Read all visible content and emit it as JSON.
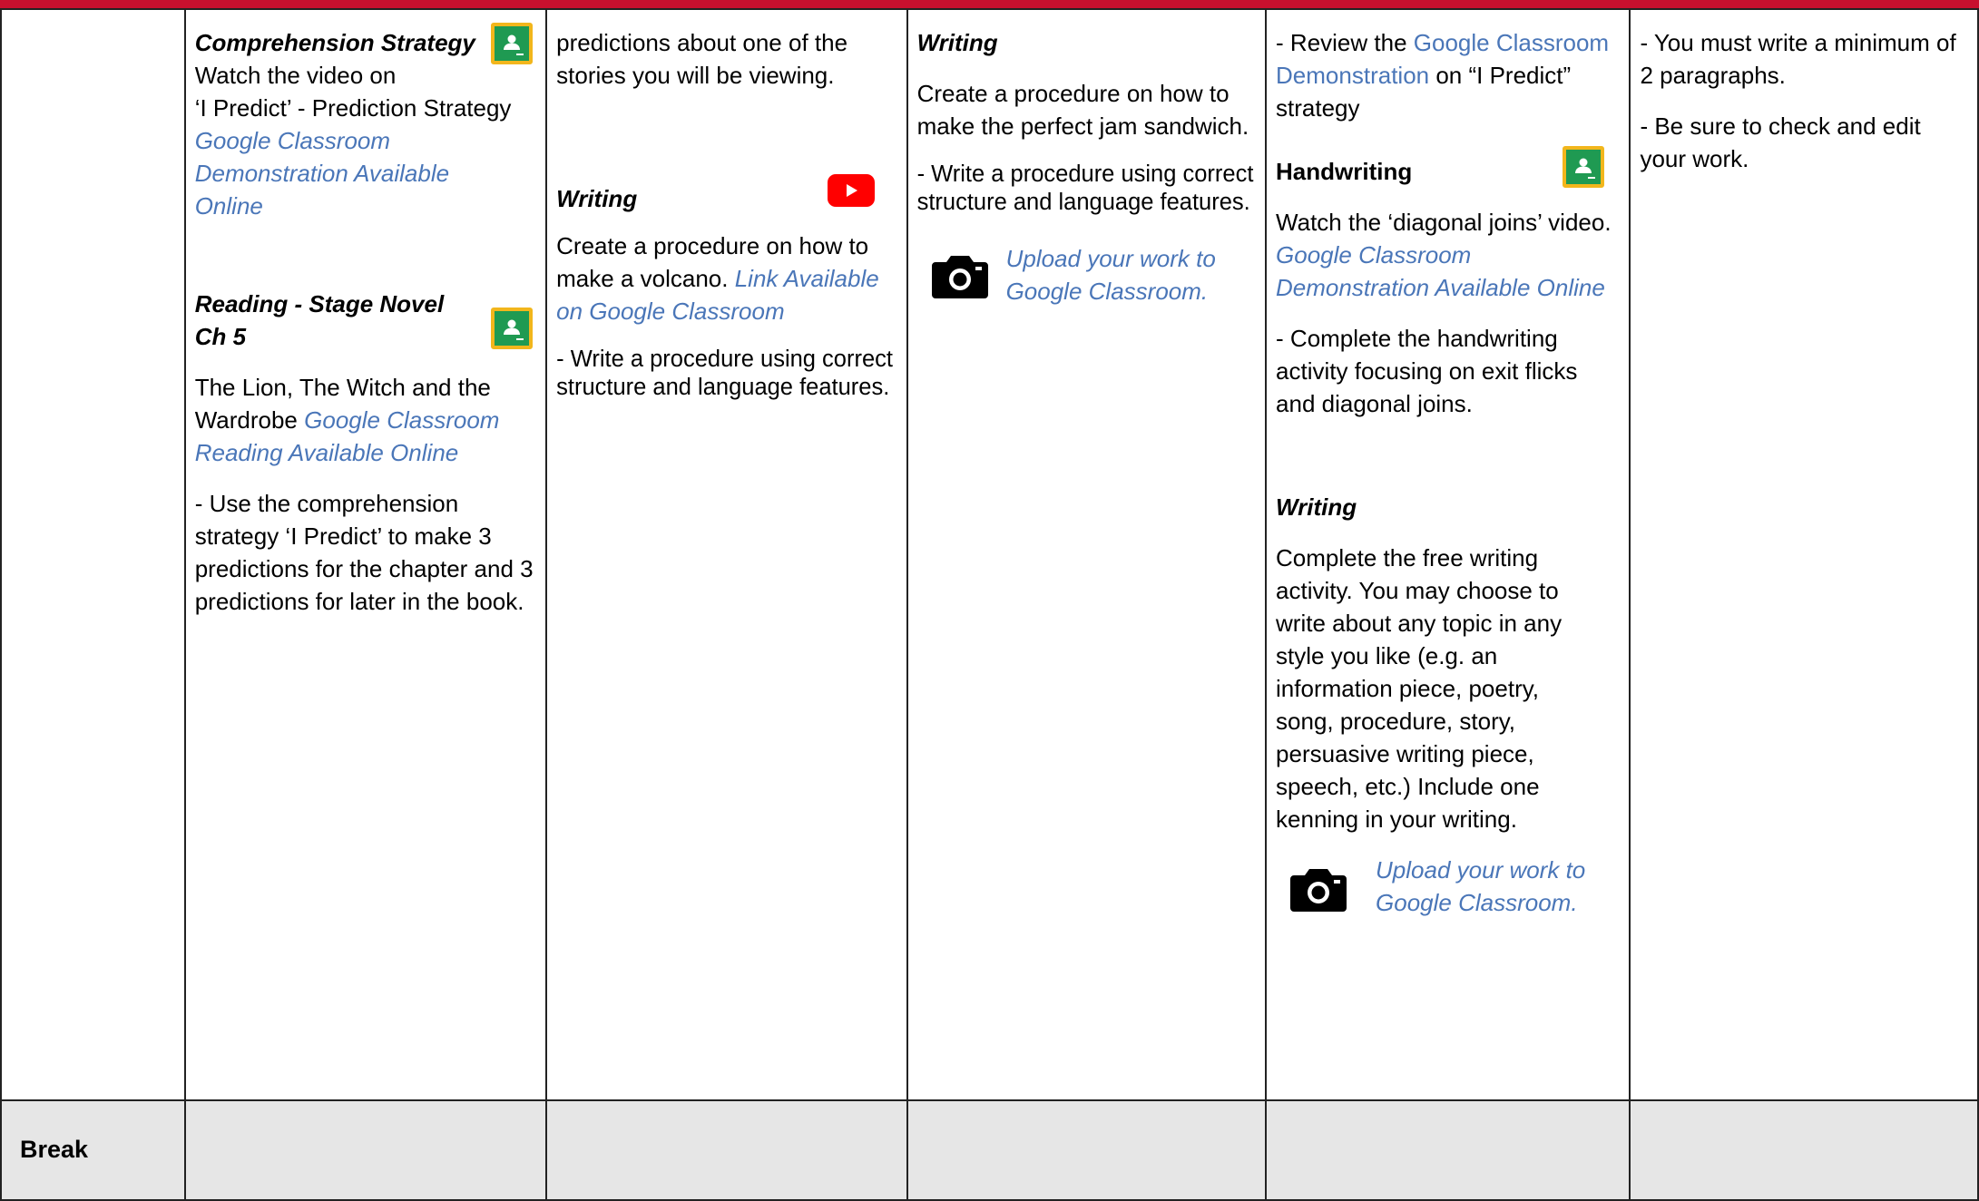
{
  "col1": {
    "comp_heading": "Comprehension Strategy",
    "comp_line1": "Watch the video on",
    "comp_line2": "‘I Predict’ - Prediction Strategy",
    "comp_link": "Google Classroom Demonstration Available Online",
    "reading_heading": "Reading - Stage Novel Ch 5",
    "reading_text": "The Lion, The Witch and the Wardrobe",
    "reading_link": "Google Classroom Reading Available Online",
    "reading_task": "- Use the comprehension strategy ‘I Predict’  to make 3 predictions for the chapter and 3 predictions for later in the book."
  },
  "col2": {
    "intro": "predictions about one of the stories you will be viewing.",
    "writing_heading": "Writing",
    "writing_text": "Create a procedure on how to make a volcano.",
    "writing_link": "Link Available on Google Classroom",
    "writing_task": "- Write a procedure using correct structure and language features."
  },
  "col3": {
    "writing_heading": "Writing",
    "writing_text": "Create a procedure on how to make the perfect jam sandwich.",
    "writing_task": "- Write a procedure using correct structure and language features.",
    "upload_link": "Upload your work to Google Classroom."
  },
  "col4": {
    "review_prefix": "- Review the",
    "review_link": "Google Classroom Demonstration",
    "review_suffix": "on “I Predict” strategy",
    "handwriting_heading": "Handwriting",
    "handwriting_text": "Watch the ‘diagonal joins’ video.",
    "handwriting_link": "Google Classroom Demonstration Available Online",
    "handwriting_task": "- Complete the handwriting activity focusing on exit flicks and diagonal joins.",
    "writing_heading": "Writing",
    "writing_text": "Complete the free writing activity. You may choose to write about any topic in any style you like (e.g. an information piece, poetry, song, procedure, story, persuasive writing piece, speech, etc.) Include one kenning in your writing.",
    "upload_link": "Upload your work to Google Classroom."
  },
  "col5": {
    "line1": "- You must write a minimum of 2 paragraphs.",
    "line2": "- Be sure to check and edit your work."
  },
  "break_row": {
    "label": "Break"
  },
  "colors": {
    "accent_red": "#c8102e",
    "link_blue": "#4a76b8",
    "classroom_green": "#1f9a52",
    "classroom_yellow": "#f2b61c",
    "youtube_red": "#ff0000",
    "break_gray": "#e6e6e6"
  }
}
